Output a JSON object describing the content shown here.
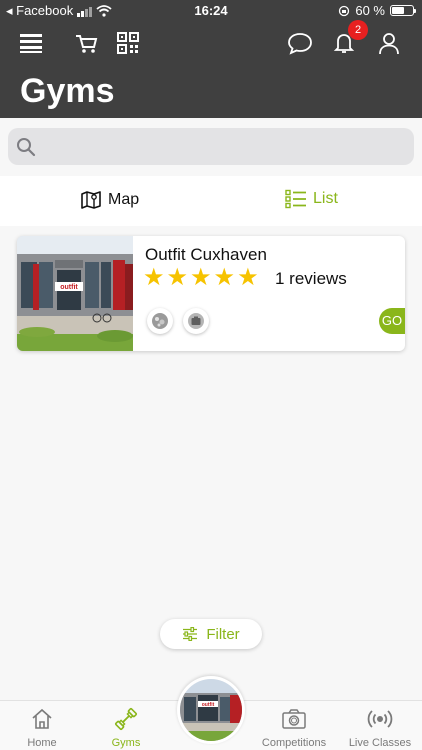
{
  "status_bar": {
    "back_app": "◂ Facebook",
    "time": "16:24",
    "battery": "60 %",
    "battery_fraction": 0.6
  },
  "header": {
    "title": "Gyms",
    "notification_count": "2"
  },
  "search": {
    "placeholder": "",
    "value": ""
  },
  "view_toggle": {
    "map_label": "Map",
    "list_label": "List",
    "active": "list"
  },
  "gyms": [
    {
      "name": "Outfit Cuxhaven",
      "rating": 5,
      "reviews": "1 reviews",
      "go_label": "GO",
      "sign_text": "outfit"
    }
  ],
  "filter": {
    "label": "Filter"
  },
  "bottom_nav": {
    "items": [
      {
        "label": "Home",
        "active": false
      },
      {
        "label": "Gyms",
        "active": true
      },
      {
        "label": "Competitions",
        "active": false
      },
      {
        "label": "Live Classes",
        "active": false
      }
    ],
    "center_sign_text": "outfit"
  },
  "colors": {
    "accent": "#8ab61b",
    "header_bg": "#404040",
    "star": "#f6c300",
    "badge": "#e82020"
  }
}
